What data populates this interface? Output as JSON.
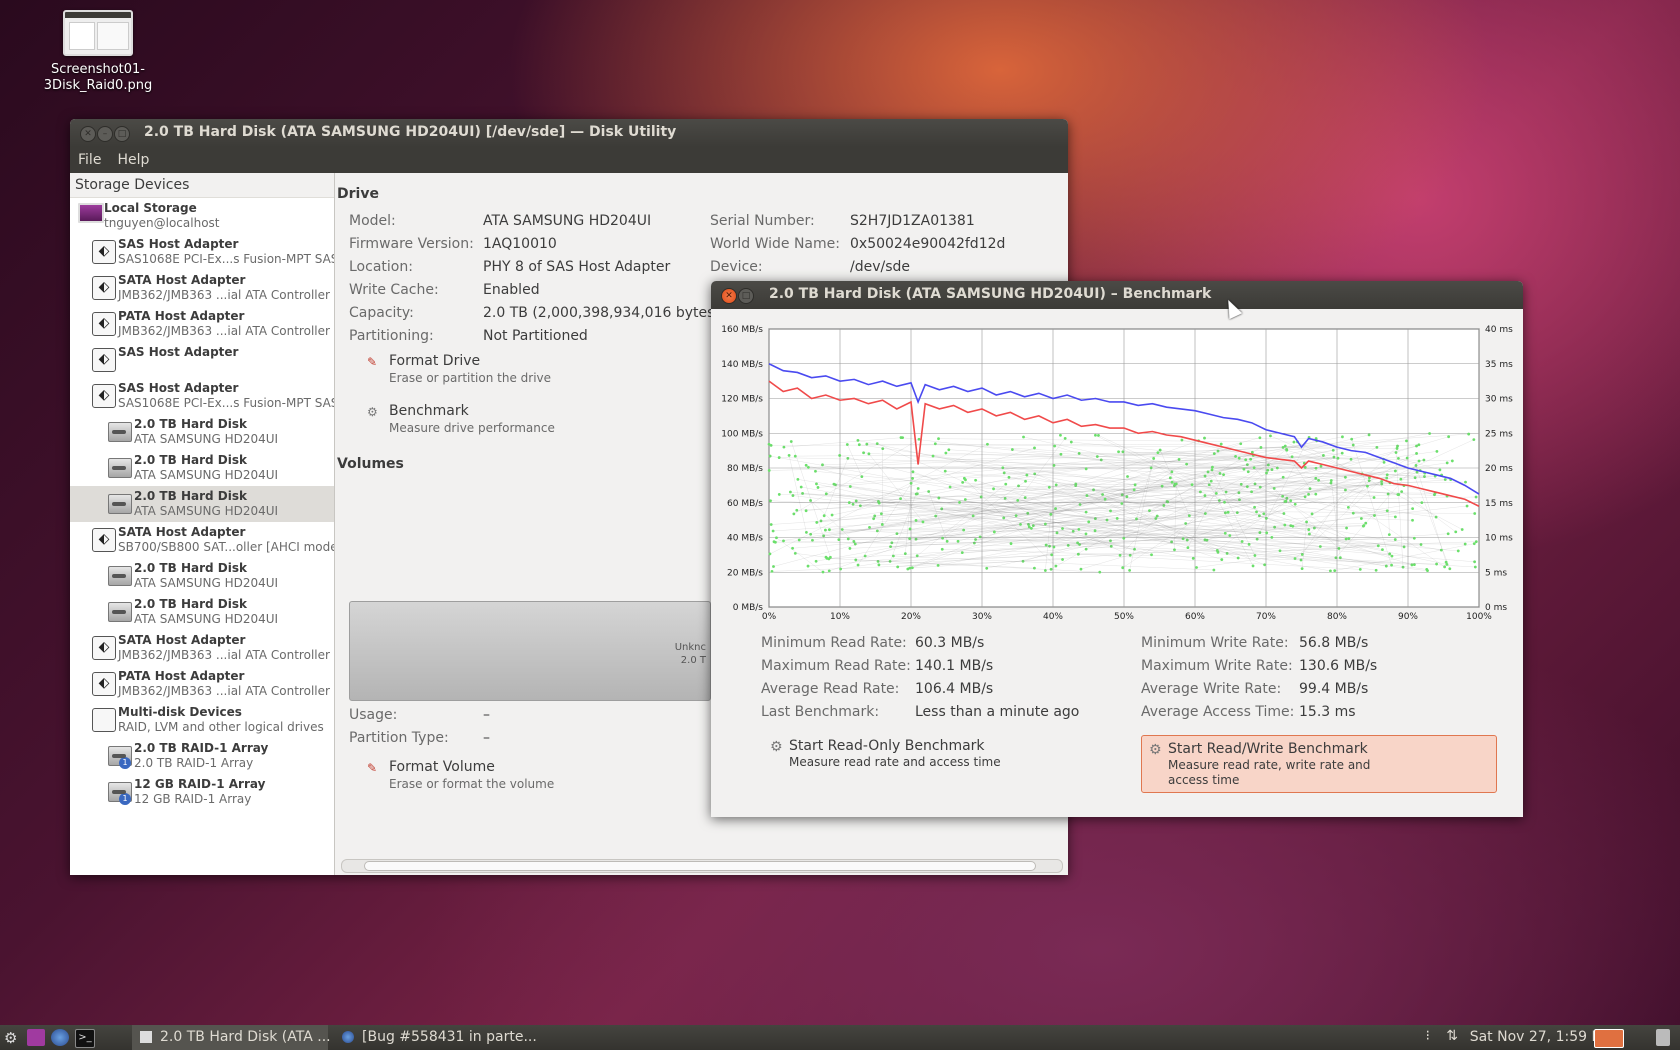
{
  "desktop": {
    "icon_label_line1": "Screenshot01-",
    "icon_label_line2": "3Disk_Raid0.png"
  },
  "main_window": {
    "title": "2.0 TB Hard Disk (ATA SAMSUNG HD204UI) [/dev/sde] — Disk Utility",
    "menu": [
      "File",
      "Help"
    ],
    "sidebar_heading": "Storage Devices",
    "sidebar": [
      {
        "title": "Local Storage",
        "sub": "tnguyen@localhost",
        "icon": "computer-icon",
        "indent": 0
      },
      {
        "title": "SAS Host Adapter",
        "sub": "SAS1068E PCI-Ex...s Fusion-MPT SAS",
        "icon": "host-adapter-icon",
        "indent": 1
      },
      {
        "title": "SATA Host Adapter",
        "sub": "JMB362/JMB363 ...ial ATA Controller",
        "icon": "host-adapter-icon",
        "indent": 1
      },
      {
        "title": "PATA Host Adapter",
        "sub": "JMB362/JMB363 ...ial ATA Controller",
        "icon": "host-adapter-icon",
        "indent": 1
      },
      {
        "title": "SAS Host Adapter",
        "sub": "",
        "icon": "host-adapter-icon",
        "indent": 1
      },
      {
        "title": "SAS Host Adapter",
        "sub": "SAS1068E PCI-Ex...s Fusion-MPT SAS",
        "icon": "host-adapter-icon",
        "indent": 1
      },
      {
        "title": "2.0 TB Hard Disk",
        "sub": "ATA SAMSUNG HD204UI",
        "icon": "hard-disk-icon",
        "indent": 2
      },
      {
        "title": "2.0 TB Hard Disk",
        "sub": "ATA SAMSUNG HD204UI",
        "icon": "hard-disk-icon",
        "indent": 2
      },
      {
        "title": "2.0 TB Hard Disk",
        "sub": "ATA SAMSUNG HD204UI",
        "icon": "hard-disk-icon",
        "indent": 2,
        "selected": true
      },
      {
        "title": "SATA Host Adapter",
        "sub": "SB700/SB800 SAT...oller [AHCI mode]",
        "icon": "host-adapter-icon",
        "indent": 1
      },
      {
        "title": "2.0 TB Hard Disk",
        "sub": "ATA SAMSUNG HD204UI",
        "icon": "hard-disk-icon",
        "indent": 2
      },
      {
        "title": "2.0 TB Hard Disk",
        "sub": "ATA SAMSUNG HD204UI",
        "icon": "hard-disk-icon",
        "indent": 2
      },
      {
        "title": "SATA Host Adapter",
        "sub": "JMB362/JMB363 ...ial ATA Controller",
        "icon": "host-adapter-icon",
        "indent": 1
      },
      {
        "title": "PATA Host Adapter",
        "sub": "JMB362/JMB363 ...ial ATA Controller",
        "icon": "host-adapter-icon",
        "indent": 1
      },
      {
        "title": "Multi-disk Devices",
        "sub": "RAID, LVM and other logical drives",
        "icon": "multi-disk-icon",
        "indent": 1
      },
      {
        "title": "2.0 TB RAID-1 Array",
        "sub": "2.0 TB RAID-1 Array",
        "icon": "raid-array-icon",
        "indent": 2
      },
      {
        "title": "12 GB RAID-1 Array",
        "sub": "12 GB RAID-1 Array",
        "icon": "raid-array-icon",
        "indent": 2
      }
    ],
    "drive_section": "Drive",
    "drive_left": [
      {
        "k": "Model:",
        "v": "ATA SAMSUNG HD204UI"
      },
      {
        "k": "Firmware Version:",
        "v": "1AQ10010"
      },
      {
        "k": "Location:",
        "v": "PHY 8 of SAS Host Adapter"
      },
      {
        "k": "Write Cache:",
        "v": "Enabled"
      },
      {
        "k": "Capacity:",
        "v": "2.0 TB (2,000,398,934,016 bytes)"
      },
      {
        "k": "Partitioning:",
        "v": "Not Partitioned"
      }
    ],
    "drive_right": [
      {
        "k": "Serial Number:",
        "v": "S2H7JD1ZA01381"
      },
      {
        "k": "World Wide Name:",
        "v": "0x50024e90042fd12d"
      },
      {
        "k": "Device:",
        "v": "/dev/sde"
      }
    ],
    "format_drive": {
      "label": "Format Drive",
      "desc": "Erase or partition the drive"
    },
    "benchmark": {
      "label": "Benchmark",
      "desc": "Measure drive performance"
    },
    "volumes_section": "Volumes",
    "volume_bar_line1": "Unknc",
    "volume_bar_line2": "2.0 T",
    "usage": {
      "k": "Usage:",
      "v": "–"
    },
    "partition_type": {
      "k": "Partition Type:",
      "v": "–"
    },
    "format_volume": {
      "label": "Format Volume",
      "desc": "Erase or format the volume"
    }
  },
  "bench_window": {
    "title": "2.0 TB Hard Disk (ATA SAMSUNG HD204UI) – Benchmark",
    "stats_left": [
      {
        "k": "Minimum Read Rate:",
        "v": "60.3 MB/s"
      },
      {
        "k": "Maximum Read Rate:",
        "v": "140.1 MB/s"
      },
      {
        "k": "Average Read Rate:",
        "v": "106.4 MB/s"
      },
      {
        "k": "Last Benchmark:",
        "v": "Less than a minute ago"
      }
    ],
    "stats_right": [
      {
        "k": "Minimum Write Rate:",
        "v": "56.8 MB/s"
      },
      {
        "k": "Maximum Write Rate:",
        "v": "130.6 MB/s"
      },
      {
        "k": "Average Write Rate:",
        "v": "99.4 MB/s"
      },
      {
        "k": "Average Access Time:",
        "v": "15.3 ms"
      }
    ],
    "readonly_button": {
      "label": "Start Read-Only Benchmark",
      "desc": "Measure read rate and access time"
    },
    "readwrite_button": {
      "label": "Start Read/Write Benchmark",
      "desc": "Measure read rate, write rate and access time"
    }
  },
  "chart_data": {
    "type": "line",
    "y_left_ticks": [
      "0 MB/s",
      "20 MB/s",
      "40 MB/s",
      "60 MB/s",
      "80 MB/s",
      "100 MB/s",
      "120 MB/s",
      "140 MB/s",
      "160 MB/s"
    ],
    "y_right_ticks": [
      "0 ms",
      "5 ms",
      "10 ms",
      "15 ms",
      "20 ms",
      "25 ms",
      "30 ms",
      "35 ms",
      "40 ms"
    ],
    "x_ticks": [
      "0%",
      "10%",
      "20%",
      "30%",
      "40%",
      "50%",
      "60%",
      "70%",
      "80%",
      "90%",
      "100%"
    ],
    "ylim_left": [
      0,
      160
    ],
    "ylim_right": [
      0,
      40
    ],
    "xlim": [
      0,
      100
    ],
    "grid": true,
    "series": [
      {
        "color": "#4a4af0",
        "x": [
          0,
          2,
          4,
          6,
          8,
          10,
          12,
          14,
          16,
          18,
          20,
          21,
          22,
          24,
          26,
          28,
          30,
          32,
          34,
          36,
          38,
          40,
          42,
          44,
          46,
          48,
          50,
          52,
          54,
          56,
          58,
          60,
          62,
          64,
          66,
          68,
          70,
          72,
          74,
          75,
          76,
          78,
          80,
          82,
          84,
          86,
          88,
          90,
          92,
          94,
          96,
          98,
          100
        ],
        "values": [
          140,
          136,
          135,
          132,
          133,
          130,
          131,
          128,
          130,
          127,
          129,
          118,
          128,
          125,
          127,
          124,
          126,
          122,
          124,
          121,
          123,
          120,
          122,
          119,
          120,
          118,
          118,
          116,
          117,
          115,
          114,
          113,
          111,
          109,
          108,
          106,
          102,
          100,
          98,
          92,
          97,
          95,
          92,
          90,
          89,
          86,
          83,
          80,
          78,
          76,
          74,
          70,
          65
        ]
      },
      {
        "color": "#f04a4a",
        "x": [
          0,
          2,
          4,
          6,
          8,
          10,
          12,
          14,
          16,
          18,
          20,
          21,
          22,
          24,
          26,
          28,
          30,
          32,
          34,
          36,
          38,
          40,
          42,
          44,
          46,
          48,
          50,
          52,
          54,
          56,
          58,
          60,
          62,
          64,
          66,
          68,
          70,
          72,
          74,
          75,
          76,
          78,
          80,
          82,
          84,
          86,
          88,
          90,
          92,
          94,
          96,
          98,
          100
        ],
        "values": [
          130,
          124,
          126,
          120,
          122,
          119,
          120,
          117,
          119,
          114,
          118,
          82,
          117,
          114,
          116,
          112,
          114,
          110,
          112,
          108,
          110,
          106,
          108,
          104,
          105,
          103,
          103,
          100,
          101,
          99,
          98,
          96,
          94,
          92,
          90,
          88,
          86,
          85,
          84,
          80,
          84,
          82,
          80,
          78,
          76,
          74,
          71,
          70,
          68,
          66,
          64,
          62,
          58
        ]
      }
    ],
    "access_time_cloud_ms": [
      5,
      25
    ]
  },
  "taskbar": {
    "task1": "2.0 TB Hard Disk (ATA ...",
    "task2": "[Bug #558431 in parte...",
    "clock": "Sat Nov 27,  1:59 PM"
  }
}
